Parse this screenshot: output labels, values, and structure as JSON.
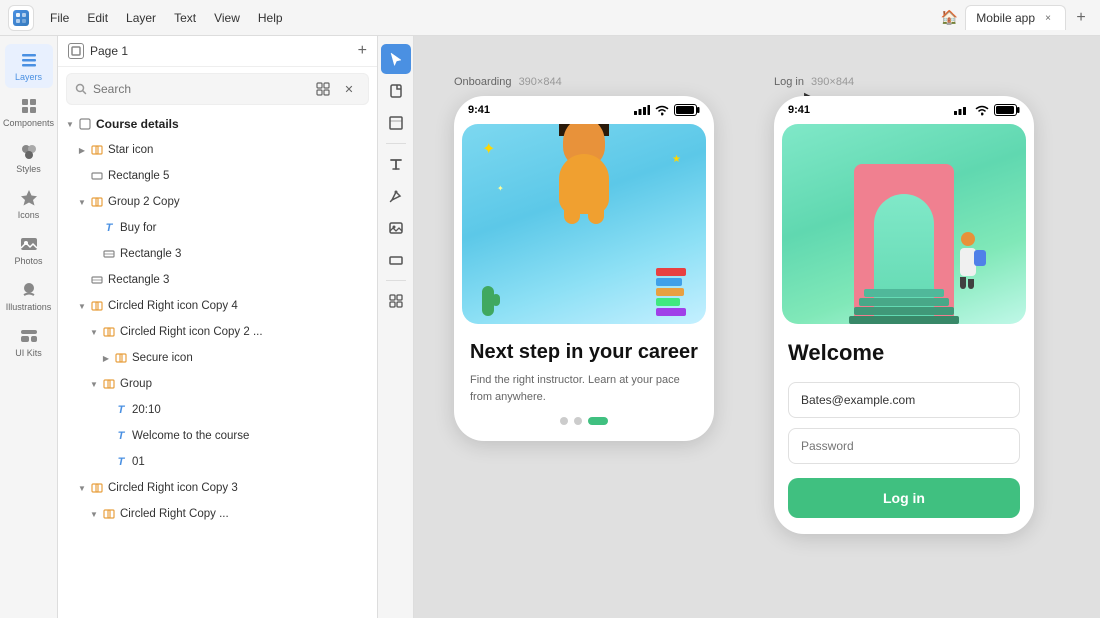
{
  "app": {
    "logo": "L",
    "menu_items": [
      "File",
      "Edit",
      "Layer",
      "Text",
      "View",
      "Help"
    ]
  },
  "tabs": {
    "home_icon": "🏠",
    "active_tab": "Mobile app",
    "close_label": "×",
    "add_label": "+"
  },
  "left_sidebar": {
    "items": [
      {
        "id": "layers",
        "label": "Layers",
        "active": true
      },
      {
        "id": "components",
        "label": "Components",
        "active": false
      },
      {
        "id": "styles",
        "label": "Styles",
        "active": false
      },
      {
        "id": "icons",
        "label": "Icons",
        "active": false
      },
      {
        "id": "photos",
        "label": "Photos",
        "active": false
      },
      {
        "id": "illustrations",
        "label": "Illustrations",
        "active": false
      },
      {
        "id": "ui-kits",
        "label": "UI Kits",
        "active": false
      }
    ]
  },
  "layers_panel": {
    "page_name": "Page 1",
    "search_placeholder": "Search",
    "section": "Course details",
    "items": [
      {
        "id": "star-icon",
        "label": "Star icon",
        "type": "group",
        "indent": 1,
        "has_chevron": true,
        "collapsed": true
      },
      {
        "id": "rectangle-5",
        "label": "Rectangle 5",
        "type": "rect",
        "indent": 1,
        "has_chevron": false
      },
      {
        "id": "group-2-copy",
        "label": "Group 2 Copy",
        "type": "group",
        "indent": 1,
        "has_chevron": true,
        "collapsed": false
      },
      {
        "id": "buy-for",
        "label": "Buy for",
        "type": "text",
        "indent": 2,
        "has_chevron": false
      },
      {
        "id": "rectangle-3-nested",
        "label": "Rectangle 3",
        "type": "rect",
        "indent": 2,
        "has_chevron": false
      },
      {
        "id": "rectangle-3",
        "label": "Rectangle 3",
        "type": "rect",
        "indent": 1,
        "has_chevron": false
      },
      {
        "id": "circled-right-4",
        "label": "Circled Right icon Copy 4",
        "type": "group",
        "indent": 1,
        "has_chevron": true,
        "collapsed": false
      },
      {
        "id": "circled-right-2",
        "label": "Circled Right icon Copy 2 ...",
        "type": "group",
        "indent": 2,
        "has_chevron": true,
        "collapsed": false
      },
      {
        "id": "secure-icon",
        "label": "Secure icon",
        "type": "group",
        "indent": 3,
        "has_chevron": true,
        "collapsed": true
      },
      {
        "id": "group",
        "label": "Group",
        "type": "group",
        "indent": 2,
        "has_chevron": true,
        "collapsed": false
      },
      {
        "id": "time",
        "label": "20:10",
        "type": "text",
        "indent": 3,
        "has_chevron": false
      },
      {
        "id": "welcome-text",
        "label": "Welcome to the course",
        "type": "text",
        "indent": 3,
        "has_chevron": false
      },
      {
        "id": "01",
        "label": "01",
        "type": "text",
        "indent": 3,
        "has_chevron": false
      },
      {
        "id": "circled-right-3",
        "label": "Circled Right icon Copy 3",
        "type": "group",
        "indent": 1,
        "has_chevron": true,
        "collapsed": false
      },
      {
        "id": "circled-right-copy",
        "label": "Circled Right Copy ...",
        "type": "group",
        "indent": 2,
        "has_chevron": true,
        "collapsed": false
      }
    ]
  },
  "tools": [
    {
      "id": "select",
      "icon": "▶",
      "active": true
    },
    {
      "id": "page",
      "icon": "📄",
      "active": false
    },
    {
      "id": "frame",
      "icon": "⬜",
      "active": false
    },
    {
      "id": "text",
      "icon": "T",
      "active": false
    },
    {
      "id": "pen",
      "icon": "✒",
      "active": false
    },
    {
      "id": "image",
      "icon": "🖼",
      "active": false
    },
    {
      "id": "shape",
      "icon": "▭",
      "active": false
    },
    {
      "id": "grid",
      "icon": "⊞",
      "active": false
    }
  ],
  "canvas": {
    "frames": [
      {
        "id": "onboarding",
        "label": "Onboarding",
        "dimensions": "390×844",
        "time": "9:41",
        "screen": "onboarding",
        "title": "Next step in your career",
        "description": "Find the right instructor.\nLearn at your pace from anywhere.",
        "dots": [
          false,
          false,
          true
        ]
      },
      {
        "id": "login",
        "label": "Log in",
        "dimensions": "390×844",
        "time": "9:41",
        "screen": "login",
        "title": "Welcome",
        "email_value": "Bates@example.com",
        "password_placeholder": "Password",
        "button_label": "Log in"
      }
    ]
  }
}
